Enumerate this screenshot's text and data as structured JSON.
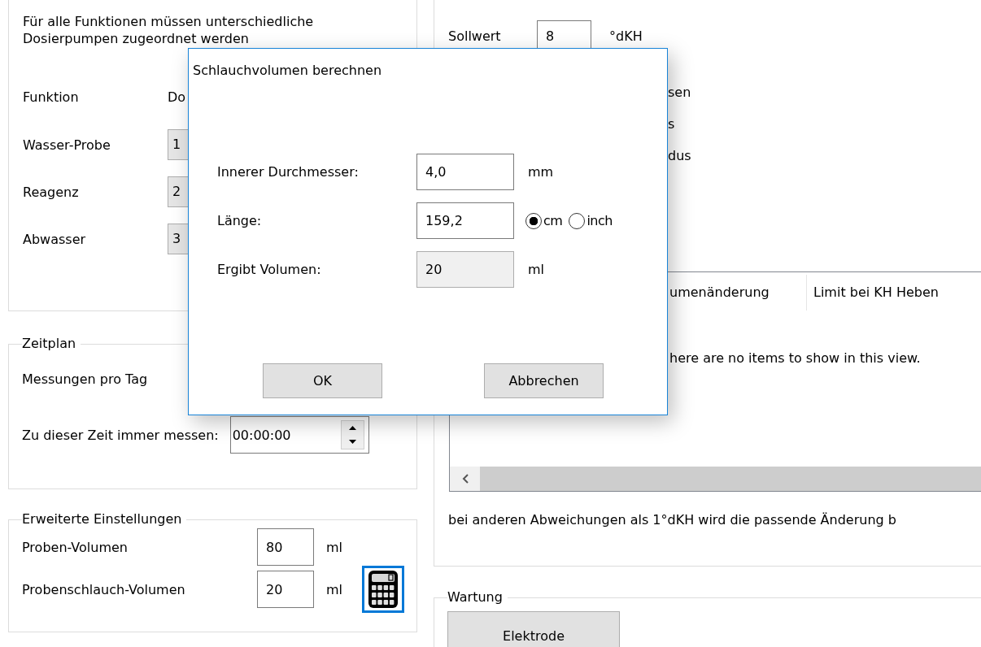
{
  "pump_assignment": {
    "note": "Für alle Funktionen müssen unterschiedliche Dosierpumpen zugeordnet werden",
    "column_headers": [
      "Funktion",
      "Do"
    ],
    "rows": [
      {
        "function": "Wasser-Probe",
        "pump": "1"
      },
      {
        "function": "Reagenz",
        "pump": "2"
      },
      {
        "function": "Abwasser",
        "pump": "3"
      }
    ]
  },
  "schedule": {
    "title": "Zeitplan",
    "measurements_label": "Messungen pro Tag",
    "fixed_time_label": "Zu dieser Zeit immer messen:",
    "fixed_time": "00:00:00"
  },
  "advanced": {
    "title": "Erweiterte Einstellungen",
    "fields": [
      {
        "label": "Proben-Volumen",
        "value": "80",
        "unit": "ml"
      },
      {
        "label": "Probenschlauch-Volumen",
        "value": "20",
        "unit": "ml"
      }
    ]
  },
  "setpoint": {
    "label": "Sollwert",
    "value": "8",
    "unit": "°dKH"
  },
  "option_fragments": [
    "sen",
    "s",
    "dus"
  ],
  "table": {
    "columns": [
      "umenänderung",
      "Limit bei KH Heben"
    ],
    "empty_text": "here are no items to show in this view."
  },
  "note": "bei anderen Abweichungen als 1°dKH wird die passende Änderung b",
  "maintenance": {
    "title": "Wartung",
    "buttons": [
      "Elektrode"
    ]
  },
  "dialog": {
    "title": "Schlauchvolumen berechnen",
    "fields": [
      {
        "kind": "input",
        "label": "Innerer Durchmesser:",
        "value": "4,0",
        "unit": "mm"
      },
      {
        "kind": "units",
        "label": "Länge:",
        "value": "159,2",
        "units": [
          {
            "label": "cm",
            "selected": true
          },
          {
            "label": "inch",
            "selected": false
          }
        ]
      },
      {
        "kind": "readonly",
        "label": "Ergibt Volumen:",
        "value": "20",
        "unit": "ml"
      }
    ],
    "buttons": [
      "OK",
      "Abbrechen"
    ]
  }
}
